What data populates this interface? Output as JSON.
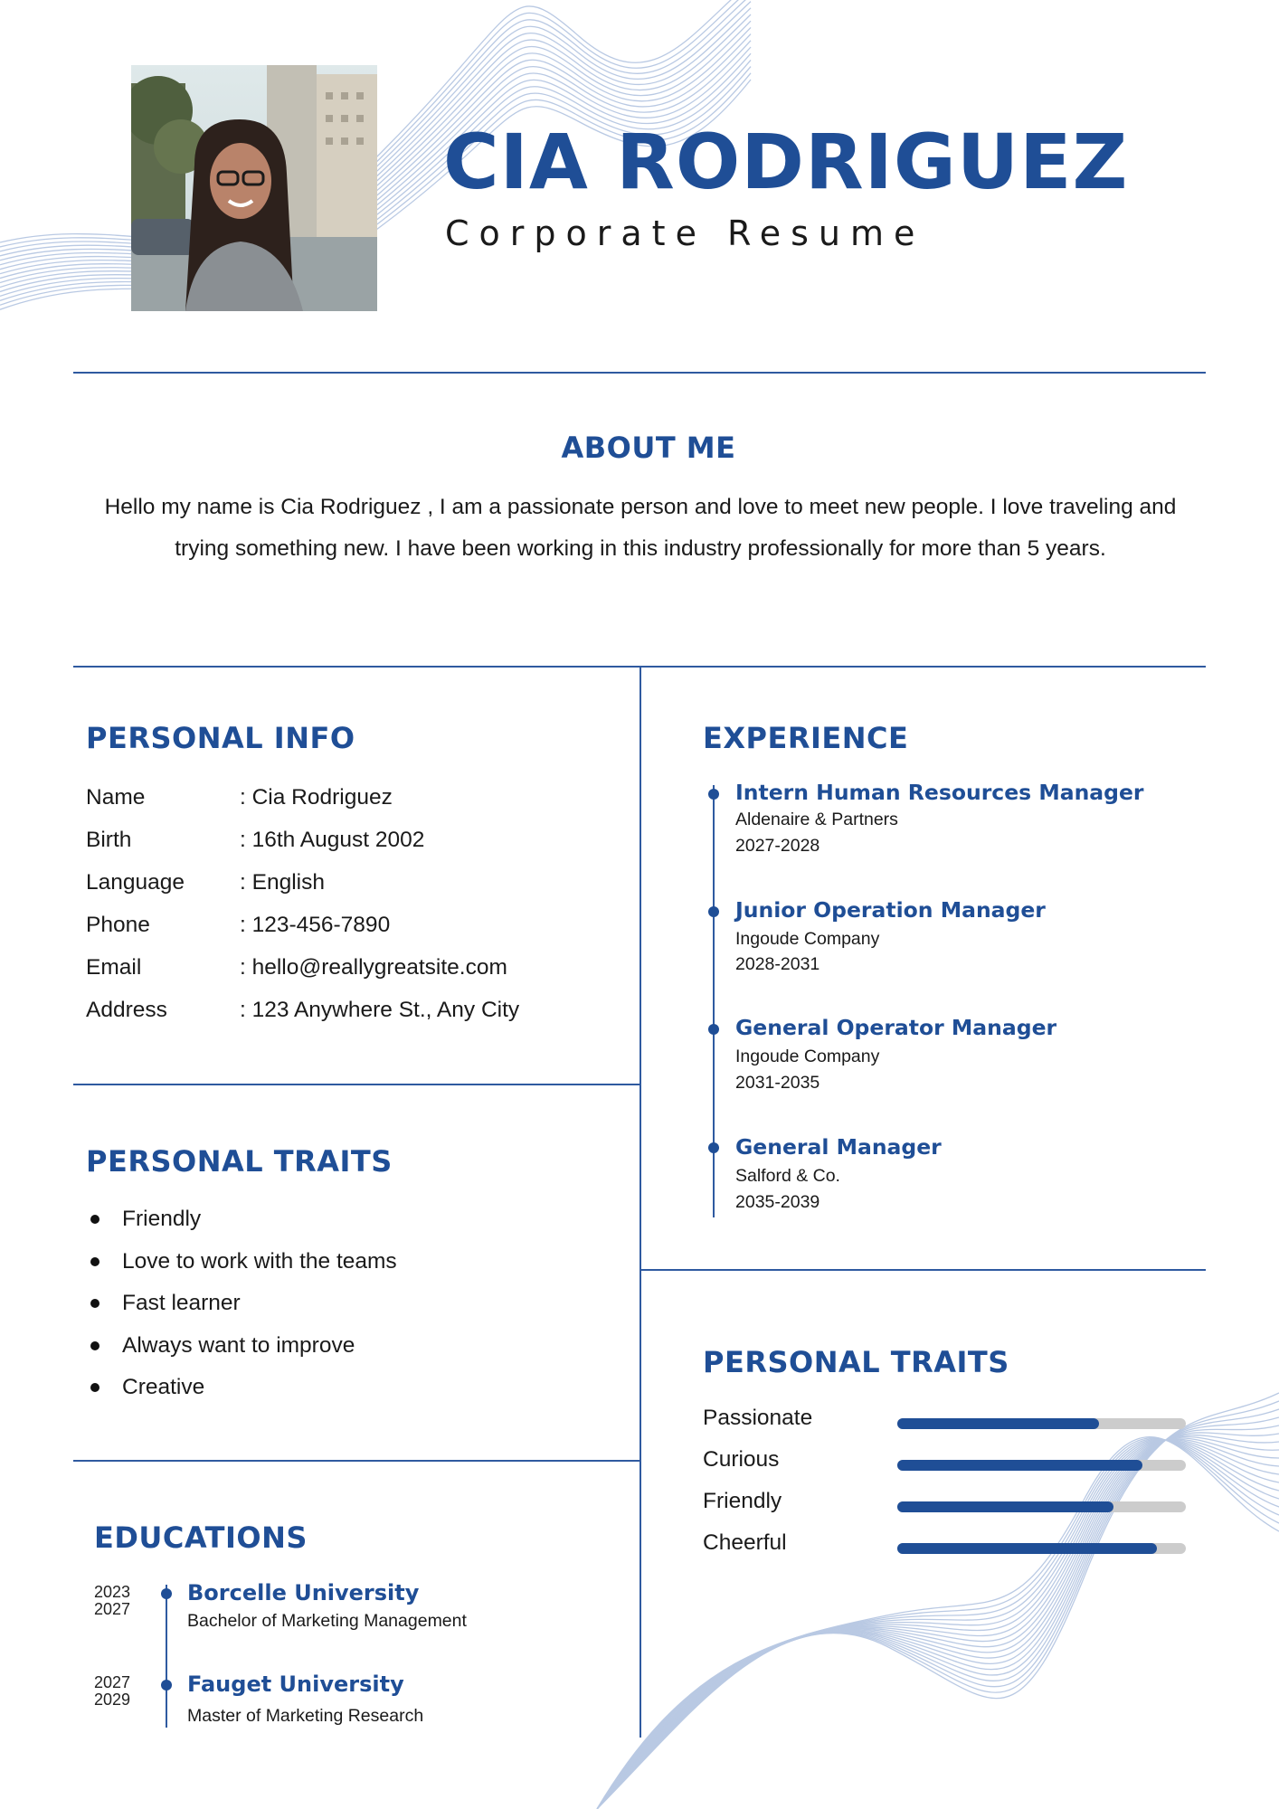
{
  "header": {
    "name": "CIA RODRIGUEZ",
    "subtitle": "Corporate Resume"
  },
  "about": {
    "title": "ABOUT ME",
    "text": "Hello my name is Cia Rodriguez , I am a passionate person and love to meet new people. I love traveling and trying something new. I have been working in this industry professionally for more than 5 years."
  },
  "personal_info": {
    "title": "PERSONAL INFO",
    "rows": [
      {
        "label": "Name",
        "value": ": Cia Rodriguez"
      },
      {
        "label": "Birth",
        "value": ": 16th August 2002"
      },
      {
        "label": "Language",
        "value": ": English"
      },
      {
        "label": "Phone",
        "value": ": 123-456-7890"
      },
      {
        "label": "Email",
        "value": ": hello@reallygreatsite.com"
      },
      {
        "label": "Address",
        "value": ": 123 Anywhere St., Any City"
      }
    ]
  },
  "traits_list": {
    "title": "PERSONAL TRAITS",
    "items": [
      "Friendly",
      "Love to work with the teams",
      "Fast learner",
      "Always want to improve",
      "Creative"
    ]
  },
  "educations": {
    "title": "EDUCATIONS",
    "items": [
      {
        "start": "2023",
        "end": "2027",
        "school": "Borcelle University",
        "degree": "Bachelor of Marketing Management"
      },
      {
        "start": "2027",
        "end": "2029",
        "school": "Fauget University",
        "degree": "Master of Marketing Research"
      }
    ]
  },
  "experience": {
    "title": "EXPERIENCE",
    "items": [
      {
        "role": "Intern Human Resources Manager",
        "company": "Aldenaire & Partners",
        "years": "2027-2028"
      },
      {
        "role": "Junior Operation Manager",
        "company": "Ingoude Company",
        "years": "2028-2031"
      },
      {
        "role": "General Operator Manager",
        "company": "Ingoude Company",
        "years": "2031-2035"
      },
      {
        "role": "General Manager",
        "company": "Salford & Co.",
        "years": "2035-2039"
      }
    ]
  },
  "skill_bars": {
    "title": "PERSONAL TRAITS",
    "items": [
      {
        "label": "Passionate",
        "level": 0.7
      },
      {
        "label": "Curious",
        "level": 0.85
      },
      {
        "label": "Friendly",
        "level": 0.75
      },
      {
        "label": "Cheerful",
        "level": 0.9
      }
    ]
  },
  "colors": {
    "accent": "#1f4e96",
    "track": "#cccccc",
    "line_art": "#b9c9e3"
  }
}
